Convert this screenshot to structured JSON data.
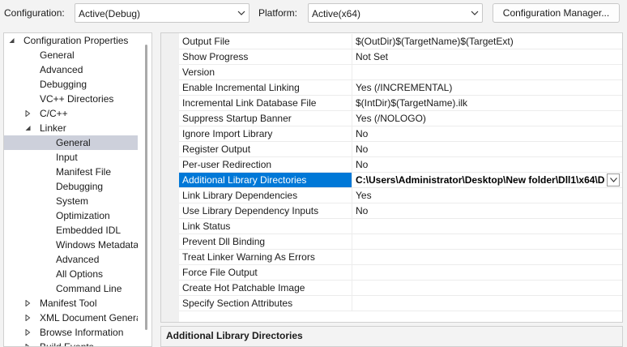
{
  "toolbar": {
    "configuration_label": "Configuration:",
    "configuration_value": "Active(Debug)",
    "platform_label": "Platform:",
    "platform_value": "Active(x64)",
    "config_manager_button": "Configuration Manager..."
  },
  "tree": {
    "items": [
      {
        "label": "Configuration Properties",
        "level": 0,
        "expander": "expanded"
      },
      {
        "label": "General",
        "level": 1,
        "expander": "none"
      },
      {
        "label": "Advanced",
        "level": 1,
        "expander": "none"
      },
      {
        "label": "Debugging",
        "level": 1,
        "expander": "none"
      },
      {
        "label": "VC++ Directories",
        "level": 1,
        "expander": "none"
      },
      {
        "label": "C/C++",
        "level": 1,
        "expander": "collapsed"
      },
      {
        "label": "Linker",
        "level": 1,
        "expander": "expanded"
      },
      {
        "label": "General",
        "level": 2,
        "expander": "none",
        "selected": true
      },
      {
        "label": "Input",
        "level": 2,
        "expander": "none"
      },
      {
        "label": "Manifest File",
        "level": 2,
        "expander": "none"
      },
      {
        "label": "Debugging",
        "level": 2,
        "expander": "none"
      },
      {
        "label": "System",
        "level": 2,
        "expander": "none"
      },
      {
        "label": "Optimization",
        "level": 2,
        "expander": "none"
      },
      {
        "label": "Embedded IDL",
        "level": 2,
        "expander": "none"
      },
      {
        "label": "Windows Metadata",
        "level": 2,
        "expander": "none"
      },
      {
        "label": "Advanced",
        "level": 2,
        "expander": "none"
      },
      {
        "label": "All Options",
        "level": 2,
        "expander": "none"
      },
      {
        "label": "Command Line",
        "level": 2,
        "expander": "none"
      },
      {
        "label": "Manifest Tool",
        "level": 1,
        "expander": "collapsed"
      },
      {
        "label": "XML Document Genera",
        "level": 1,
        "expander": "collapsed"
      },
      {
        "label": "Browse Information",
        "level": 1,
        "expander": "collapsed"
      },
      {
        "label": "Build Events",
        "level": 1,
        "expander": "collapsed"
      }
    ]
  },
  "properties": [
    {
      "name": "Output File",
      "value": "$(OutDir)$(TargetName)$(TargetExt)"
    },
    {
      "name": "Show Progress",
      "value": "Not Set"
    },
    {
      "name": "Version",
      "value": ""
    },
    {
      "name": "Enable Incremental Linking",
      "value": "Yes (/INCREMENTAL)"
    },
    {
      "name": "Incremental Link Database File",
      "value": "$(IntDir)$(TargetName).ilk"
    },
    {
      "name": "Suppress Startup Banner",
      "value": "Yes (/NOLOGO)"
    },
    {
      "name": "Ignore Import Library",
      "value": "No"
    },
    {
      "name": "Register Output",
      "value": "No"
    },
    {
      "name": "Per-user Redirection",
      "value": "No"
    },
    {
      "name": "Additional Library Directories",
      "value": "C:\\Users\\Administrator\\Desktop\\New folder\\Dll1\\x64\\D",
      "selected": true
    },
    {
      "name": "Link Library Dependencies",
      "value": "Yes"
    },
    {
      "name": "Use Library Dependency Inputs",
      "value": "No"
    },
    {
      "name": "Link Status",
      "value": ""
    },
    {
      "name": "Prevent Dll Binding",
      "value": ""
    },
    {
      "name": "Treat Linker Warning As Errors",
      "value": ""
    },
    {
      "name": "Force File Output",
      "value": ""
    },
    {
      "name": "Create Hot Patchable Image",
      "value": ""
    },
    {
      "name": "Specify Section Attributes",
      "value": ""
    }
  ],
  "description": {
    "title": "Additional Library Directories"
  },
  "colors": {
    "selection_blue": "#0078d7",
    "tree_selection": "#cdd0db"
  }
}
